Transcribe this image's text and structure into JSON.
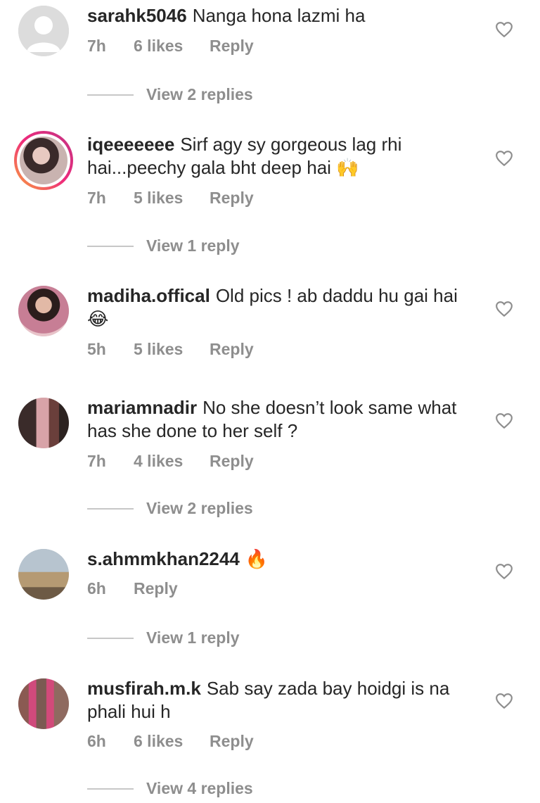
{
  "comments": [
    {
      "username": "sarahk5046",
      "text": "Nanga hona lazmi ha",
      "time": "7h",
      "likes": "6 likes",
      "reply": "Reply",
      "view_replies": "View 2 replies",
      "avatar": "default-avatar"
    },
    {
      "username": "iqeeeeeee",
      "text": "Sirf agy sy gorgeous lag rhi hai...peechy gala bht deep hai 🙌",
      "time": "7h",
      "likes": "5 likes",
      "reply": "Reply",
      "view_replies": "View 1 reply",
      "avatar": "story-ring-avatar"
    },
    {
      "username": "madiha.offical",
      "text": "Old pics ! ab daddu hu gai hai 😂",
      "time": "5h",
      "likes": "5 likes",
      "reply": "Reply",
      "avatar": "photo-avatar"
    },
    {
      "username": "mariamnadir",
      "text": "No she doesn’t look same what has she done to her self ?",
      "time": "7h",
      "likes": "4 likes",
      "reply": "Reply",
      "view_replies": "View 2 replies",
      "avatar": "photo-avatar"
    },
    {
      "username": "s.ahmmkhan2244",
      "text": "🔥",
      "time": "6h",
      "reply": "Reply",
      "view_replies": "View 1 reply",
      "avatar": "photo-avatar"
    },
    {
      "username": "musfirah.m.k",
      "text": "Sab say zada bay hoidgi is na phali hui h",
      "time": "6h",
      "likes": "6 likes",
      "reply": "Reply",
      "view_replies": "View 4 replies",
      "avatar": "photo-avatar"
    }
  ],
  "icons": {
    "like": "heart-outline-icon"
  },
  "colors": {
    "text": "#262626",
    "muted": "#8e8e8e",
    "divider": "#c7c7c7"
  }
}
